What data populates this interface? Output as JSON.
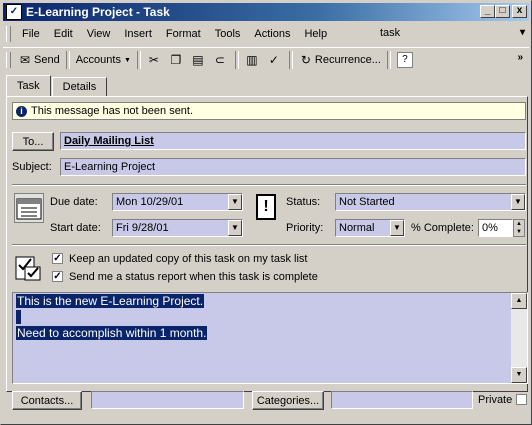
{
  "window": {
    "title": "E-Learning Project - Task",
    "title_icon": "checkmark-icon",
    "controls": {
      "minimize": "_",
      "maximize": "□",
      "close": "x"
    }
  },
  "menubar": {
    "items": [
      "File",
      "Edit",
      "View",
      "Insert",
      "Format",
      "Tools",
      "Actions",
      "Help"
    ],
    "ask_box_value": "task"
  },
  "toolbar": {
    "send": "Send",
    "accounts": "Accounts",
    "recurrence": "Recurrence..."
  },
  "tabs": [
    "Task",
    "Details"
  ],
  "info_message": "This message has not been sent.",
  "to": {
    "button": "To...",
    "value": "Daily Mailing List"
  },
  "subject": {
    "label": "Subject:",
    "value": "E-Learning Project"
  },
  "dates": {
    "due_label": "Due date:",
    "due_value": "Mon 10/29/01",
    "start_label": "Start date:",
    "start_value": "Fri 9/28/01"
  },
  "status": {
    "status_label": "Status:",
    "status_value": "Not Started",
    "priority_label": "Priority:",
    "priority_value": "Normal",
    "complete_label": "% Complete:",
    "complete_value": "0%"
  },
  "options": {
    "keep_copy": "Keep an updated copy of this task on my task list",
    "keep_copy_checked": true,
    "send_report": "Send me a status report when this task is complete",
    "send_report_checked": true
  },
  "notes": {
    "line1": "This is the new E-Learning Project.",
    "line2": " ",
    "line3": "Need to accomplish within 1 month."
  },
  "footer": {
    "contacts_button": "Contacts...",
    "categories_button": "Categories...",
    "private_label": "Private"
  },
  "colors": {
    "title_start": "#0a246a",
    "field_bg": "#c8c8e8",
    "info_bg": "#ffffe1",
    "selection": "#0a246a"
  }
}
